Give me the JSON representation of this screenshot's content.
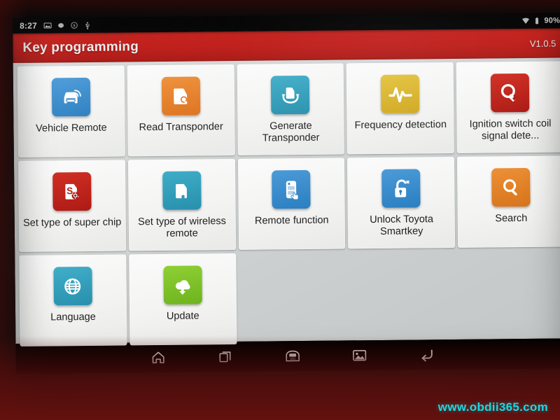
{
  "statusbar": {
    "clock": "8:27",
    "icons": [
      "screenshot-icon",
      "gear-icon",
      "dollar-circle-icon",
      "usb-icon"
    ],
    "wifi_icon": "wifi-icon",
    "battery_icon": "battery-icon",
    "battery_percent": "90%"
  },
  "titlebar": {
    "title": "Key programming",
    "version": "V1.0.5"
  },
  "colors": {
    "title_bar_red": "#c31b17",
    "blue": "#2f89cb",
    "orange": "#e8812b",
    "teal": "#2e9cb8",
    "gold": "#d9b42c",
    "red": "#bf2017",
    "search_orange": "#e08123",
    "green": "#7cbf2b",
    "watermark_cyan": "#19d9e0"
  },
  "grid": {
    "tiles": [
      {
        "label": "Vehicle Remote",
        "icon": "car-remote-icon",
        "color": "#2f89cb"
      },
      {
        "label": "Read Transponder",
        "icon": "read-transponder-icon",
        "color": "#e8812b"
      },
      {
        "label": "Generate Transponder",
        "icon": "generate-transponder-icon",
        "color": "#2e9cb8"
      },
      {
        "label": "Frequency detection",
        "icon": "waveform-icon",
        "color": "#d9b42c"
      },
      {
        "label": "Ignition switch coil signal dete...",
        "icon": "coil-signal-icon",
        "color": "#bf2017"
      },
      {
        "label": "Set type of super chip",
        "icon": "super-chip-icon",
        "color": "#bf2017"
      },
      {
        "label": "Set type of wireless remote",
        "icon": "wireless-remote-icon",
        "color": "#2e9cb8"
      },
      {
        "label": "Remote function",
        "icon": "remote-function-icon",
        "color": "#2f89cb"
      },
      {
        "label": "Unlock Toyota Smartkey",
        "icon": "unlock-icon",
        "color": "#2f89cb"
      },
      {
        "label": "Search",
        "icon": "search-icon",
        "color": "#e08123"
      },
      {
        "label": "Language",
        "icon": "globe-icon",
        "color": "#2e9cb8"
      },
      {
        "label": "Update",
        "icon": "cloud-download-icon",
        "color": "#7cbf2b"
      }
    ]
  },
  "navbar": {
    "buttons": [
      {
        "name": "home-icon",
        "label": "Home"
      },
      {
        "name": "recents-icon",
        "label": "Recent apps"
      },
      {
        "name": "vci-icon",
        "label": "VCI connection"
      },
      {
        "name": "screenshot-icon",
        "label": "Screenshot"
      },
      {
        "name": "back-icon",
        "label": "Back"
      }
    ]
  },
  "watermark": {
    "text": "www.obdii365.com"
  }
}
